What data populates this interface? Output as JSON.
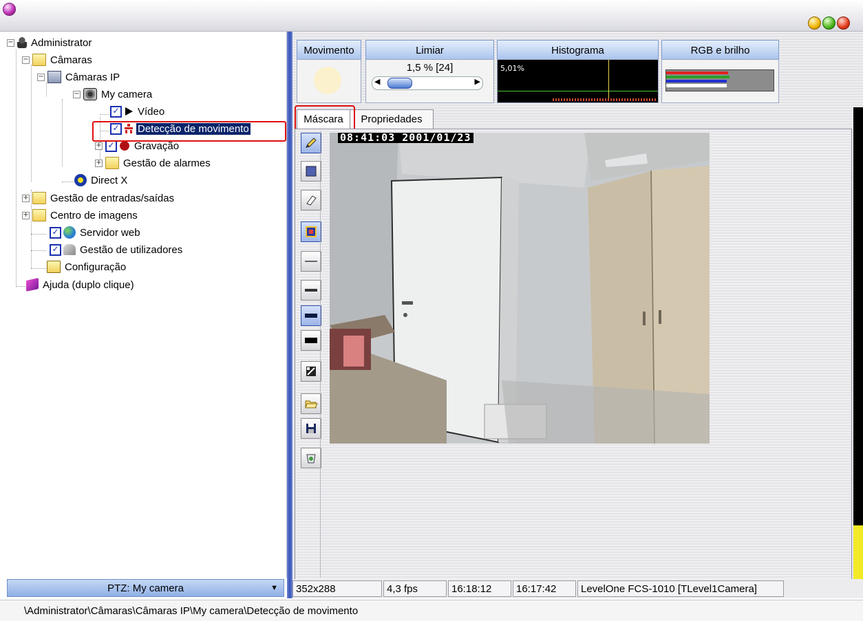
{
  "tree": {
    "items": [
      {
        "label": "Administrator"
      },
      {
        "label": "Câmaras"
      },
      {
        "label": "Câmaras IP"
      },
      {
        "label": "My camera"
      },
      {
        "label": "Vídeo"
      },
      {
        "label": "Detecção de movimento"
      },
      {
        "label": "Gravação"
      },
      {
        "label": "Gestão de alarmes"
      },
      {
        "label": "Direct X"
      },
      {
        "label": "Gestão de entradas/saídas"
      },
      {
        "label": "Centro de imagens"
      },
      {
        "label": "Servidor web"
      },
      {
        "label": "Gestão de utilizadores"
      },
      {
        "label": "Configuração"
      },
      {
        "label": "Ajuda (duplo clique)"
      }
    ]
  },
  "ptz": {
    "label": "PTZ: My camera"
  },
  "headers": {
    "movimento": "Movimento",
    "limiar": "Limiar",
    "histograma": "Histograma",
    "rgb": "RGB e brilho",
    "limiar_value": "1,5 % [24]",
    "histogram_value": "5,01%"
  },
  "tabs": {
    "mascara": "Máscara",
    "propriedades": "Propriedades"
  },
  "video": {
    "timestamp": "08:41:03 2001/01/23"
  },
  "status": {
    "resolution": "352x288",
    "fps": "4,3 fps",
    "time1": "16:18:12",
    "time2": "16:17:42",
    "camera": "LevelOne FCS-1010 [TLevel1Camera]"
  },
  "path": "\\Administrator\\Câmaras\\Câmaras IP\\My camera\\Detecção de movimento",
  "colors": {
    "accent": "#3452b6",
    "highlight": "#e01010",
    "selection": "#0a246a"
  }
}
